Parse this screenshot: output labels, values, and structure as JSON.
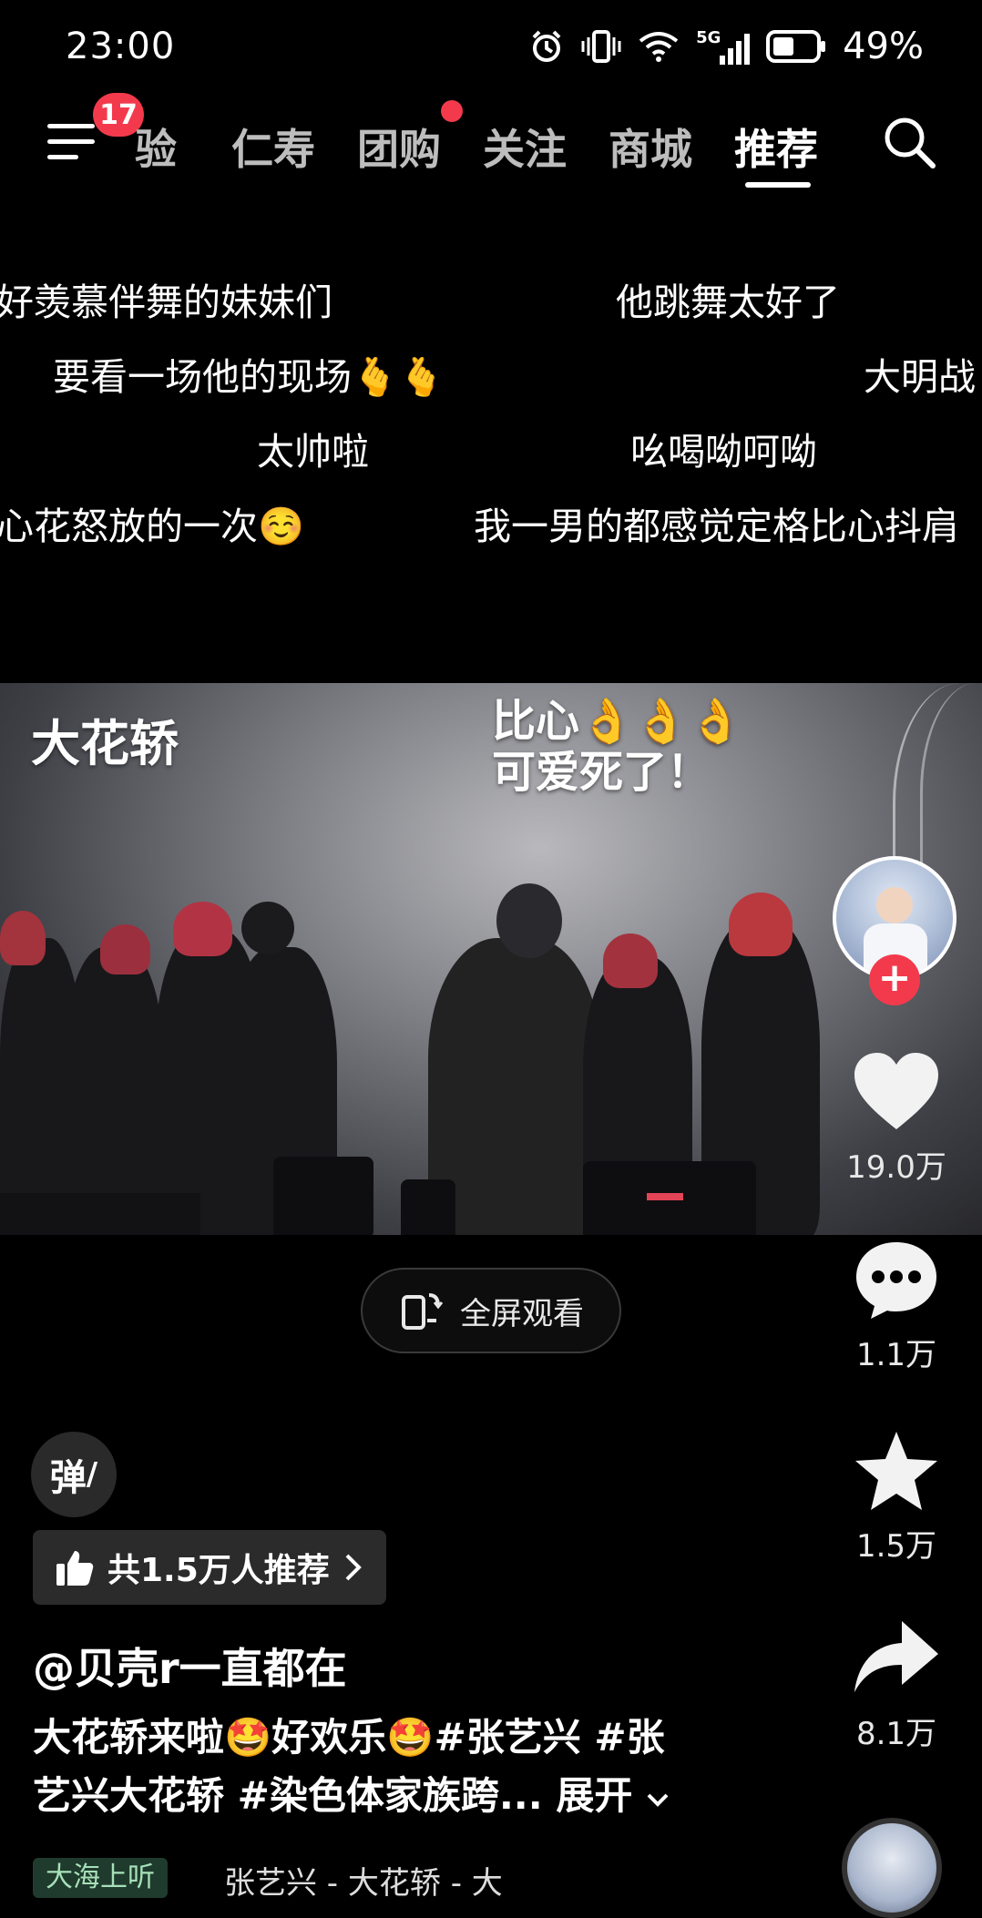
{
  "status_bar": {
    "time": "23:00",
    "network": "5G",
    "battery": "49%"
  },
  "nav": {
    "badge_count": "17",
    "tabs": [
      {
        "label": "验"
      },
      {
        "label": "仁寿"
      },
      {
        "label": "团购"
      },
      {
        "label": "关注"
      },
      {
        "label": "商城"
      },
      {
        "label": "推荐"
      }
    ]
  },
  "danmaku": [
    "好羡慕伴舞的妹妹们",
    "他跳舞太好了",
    "要看一场他的现场🫰🫰",
    "大明战",
    "太帅啦",
    "吆喝呦呵呦",
    "心花怒放的一次☺️",
    "我一男的都感觉定格比心抖肩"
  ],
  "video": {
    "title_overlay": "大花轿",
    "caption_line1": "比心👌👌👌",
    "caption_line2": "可爱死了！"
  },
  "fullscreen_button": {
    "label": "全屏观看"
  },
  "actions": {
    "likes": "19.0万",
    "comments": "1.1万",
    "favorites": "1.5万",
    "shares": "8.1万"
  },
  "danmaku_toggle": {
    "label": "弹"
  },
  "recommend": {
    "label": "共1.5万人推荐"
  },
  "post": {
    "author": "@贝壳r一直都在",
    "description_line1": "大花轿来啦🤩好欢乐🤩#张艺兴 #张",
    "description_line2": "艺兴大花轿 #染色体家族跨...",
    "expand_label": "展开"
  },
  "music": {
    "tag": "大海上听",
    "text": "张艺兴 - 大花轿 - 大"
  },
  "colors": {
    "accent_red": "#f23a4c",
    "background": "#000000"
  }
}
